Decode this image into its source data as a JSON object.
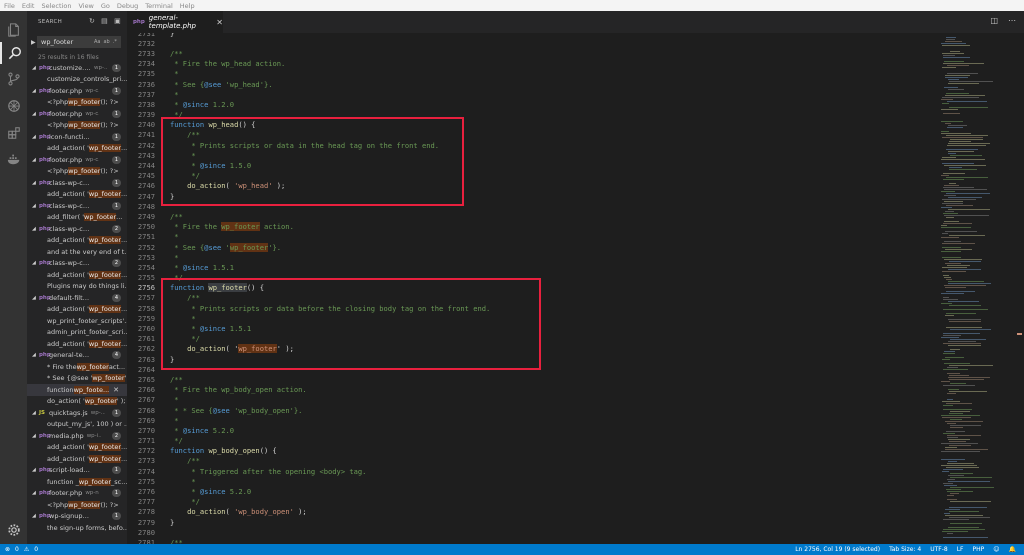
{
  "menubar": [
    "File",
    "Edit",
    "Selection",
    "View",
    "Go",
    "Debug",
    "Terminal",
    "Help"
  ],
  "sidebar": {
    "title": "SEARCH",
    "query": "wp_footer",
    "case_opt": "Aa",
    "word_opt": "ab",
    "regex_opt": ".*",
    "summary": "25 results in 16 files",
    "results": [
      {
        "kind": "file",
        "icon": "php",
        "name": "customize.php",
        "path": "wp-...",
        "count": "1"
      },
      {
        "kind": "match",
        "parts": [
          "customize_controls_pri..."
        ]
      },
      {
        "kind": "file",
        "icon": "php",
        "name": "footer.php",
        "path": "wp-c...",
        "count": "1"
      },
      {
        "kind": "match",
        "parts": [
          "<?php ",
          {
            "h": "wp_footer"
          },
          "(); ?>"
        ]
      },
      {
        "kind": "file",
        "icon": "php",
        "name": "footer.php",
        "path": "wp-c...",
        "count": "1"
      },
      {
        "kind": "match",
        "parts": [
          "<?php ",
          {
            "h": "wp_footer"
          },
          "(); ?>"
        ]
      },
      {
        "kind": "file",
        "icon": "php",
        "name": "icon-functions.p...",
        "path": "",
        "count": "1"
      },
      {
        "kind": "match",
        "parts": [
          "add_action( '",
          {
            "h": "wp_footer"
          },
          "..."
        ]
      },
      {
        "kind": "file",
        "icon": "php",
        "name": "footer.php",
        "path": "wp-c...",
        "count": "1"
      },
      {
        "kind": "match",
        "parts": [
          "<?php ",
          {
            "h": "wp_footer"
          },
          "(); ?>"
        ]
      },
      {
        "kind": "file",
        "icon": "php",
        "name": "class-wp-custo...",
        "path": "",
        "count": "1"
      },
      {
        "kind": "match",
        "parts": [
          "add_action( '",
          {
            "h": "wp_footer"
          },
          "..."
        ]
      },
      {
        "kind": "file",
        "icon": "php",
        "name": "class-wp-custo...",
        "path": "",
        "count": "1"
      },
      {
        "kind": "match",
        "parts": [
          "add_filter( '",
          {
            "h": "wp_footer"
          },
          "..."
        ]
      },
      {
        "kind": "file",
        "icon": "php",
        "name": "class-wp-custo...",
        "path": "",
        "count": "2"
      },
      {
        "kind": "match",
        "parts": [
          "add_action( '",
          {
            "h": "wp_footer"
          },
          "..."
        ]
      },
      {
        "kind": "match",
        "parts": [
          "and at the very end of t..."
        ]
      },
      {
        "kind": "file",
        "icon": "php",
        "name": "class-wp-custo...",
        "path": "",
        "count": "2"
      },
      {
        "kind": "match",
        "parts": [
          "add_action( '",
          {
            "h": "wp_footer"
          },
          "..."
        ]
      },
      {
        "kind": "match",
        "parts": [
          "Plugins may do things li..."
        ]
      },
      {
        "kind": "file",
        "icon": "php",
        "name": "default-filters.ph...",
        "path": "",
        "count": "4"
      },
      {
        "kind": "match",
        "parts": [
          "add_action( '",
          {
            "h": "wp_footer"
          },
          "..."
        ]
      },
      {
        "kind": "match",
        "parts": [
          "wp_print_footer_scripts'..."
        ]
      },
      {
        "kind": "match",
        "parts": [
          "admin_print_footer_scri..."
        ]
      },
      {
        "kind": "match",
        "parts": [
          "add_action( '",
          {
            "h": "wp_footer"
          },
          "..."
        ]
      },
      {
        "kind": "file",
        "icon": "php",
        "name": "general-templat...",
        "path": "",
        "count": "4"
      },
      {
        "kind": "match",
        "parts": [
          "* Fire the ",
          {
            "h": "wp_footer"
          },
          " act..."
        ]
      },
      {
        "kind": "match",
        "parts": [
          "* See {@see '",
          {
            "h": "wp_footer"
          },
          "'}."
        ]
      },
      {
        "kind": "match",
        "selected": true,
        "parts": [
          "function ",
          {
            "h": "wp_foote..."
          }
        ]
      },
      {
        "kind": "match",
        "parts": [
          "do_action( '",
          {
            "h": "wp_footer"
          },
          "' );"
        ]
      },
      {
        "kind": "file",
        "icon": "js",
        "name": "quicktags.js",
        "path": "wp-...",
        "count": "1"
      },
      {
        "kind": "match",
        "parts": [
          "output_my_js', 100 ) or ..."
        ]
      },
      {
        "kind": "file",
        "icon": "php",
        "name": "media.php",
        "path": "wp-i...",
        "count": "2"
      },
      {
        "kind": "match",
        "parts": [
          "add_action( '",
          {
            "h": "wp_footer"
          },
          "..."
        ]
      },
      {
        "kind": "match",
        "parts": [
          "add_action( '",
          {
            "h": "wp_footer"
          },
          "..."
        ]
      },
      {
        "kind": "file",
        "icon": "php",
        "name": "script-loader.ph...",
        "path": "",
        "count": "1"
      },
      {
        "kind": "match",
        "parts": [
          "function _",
          {
            "h": "wp_footer"
          },
          "_sc..."
        ]
      },
      {
        "kind": "file",
        "icon": "php",
        "name": "footer.php",
        "path": "wp-n...",
        "count": "1"
      },
      {
        "kind": "match",
        "parts": [
          "<?php ",
          {
            "h": "wp_footer"
          },
          "(); ?>"
        ]
      },
      {
        "kind": "file",
        "icon": "php",
        "name": "wp-signup.php",
        "path": "",
        "count": "1"
      },
      {
        "kind": "match",
        "parts": [
          "the sign-up forms, befo..."
        ]
      }
    ]
  },
  "tab": {
    "label": "general-template.php",
    "icon": "php"
  },
  "editor": {
    "current_line": "2756",
    "lines": [
      {
        "n": "2731",
        "t": [
          [
            "}",
            ""
          ]
        ]
      },
      {
        "n": "2732",
        "t": []
      },
      {
        "n": "2733",
        "t": [
          [
            "/**",
            "c"
          ]
        ]
      },
      {
        "n": "2734",
        "t": [
          [
            " * Fire the wp_head action.",
            "c"
          ]
        ]
      },
      {
        "n": "2735",
        "t": [
          [
            " *",
            "c"
          ]
        ]
      },
      {
        "n": "2736",
        "t": [
          [
            " * See {",
            "c"
          ],
          [
            "@see",
            "kw"
          ],
          [
            " 'wp_head'}.",
            "c"
          ]
        ]
      },
      {
        "n": "2737",
        "t": [
          [
            " *",
            "c"
          ]
        ]
      },
      {
        "n": "2738",
        "t": [
          [
            " * ",
            "c"
          ],
          [
            "@since",
            "kw"
          ],
          [
            " 1.2.0",
            "c"
          ]
        ]
      },
      {
        "n": "2739",
        "t": [
          [
            " */",
            "c"
          ]
        ]
      },
      {
        "n": "2740",
        "t": [
          [
            "function",
            "kw"
          ],
          [
            " ",
            ""
          ],
          [
            "wp_head",
            "fnname"
          ],
          [
            "() {",
            ""
          ]
        ]
      },
      {
        "n": "2741",
        "t": [
          [
            "    /**",
            "c"
          ]
        ]
      },
      {
        "n": "2742",
        "t": [
          [
            "     * Prints scripts or data in the head tag on the front end.",
            "c"
          ]
        ]
      },
      {
        "n": "2743",
        "t": [
          [
            "     *",
            "c"
          ]
        ]
      },
      {
        "n": "2744",
        "t": [
          [
            "     * ",
            "c"
          ],
          [
            "@since",
            "kw"
          ],
          [
            " 1.5.0",
            "c"
          ]
        ]
      },
      {
        "n": "2745",
        "t": [
          [
            "     */",
            "c"
          ]
        ]
      },
      {
        "n": "2746",
        "t": [
          [
            "    ",
            ""
          ],
          [
            "do_action",
            "fnname"
          ],
          [
            "( ",
            ""
          ],
          [
            "'wp_head'",
            "str"
          ],
          [
            " );",
            ""
          ]
        ]
      },
      {
        "n": "2747",
        "t": [
          [
            "}",
            ""
          ]
        ]
      },
      {
        "n": "2748",
        "t": []
      },
      {
        "n": "2749",
        "t": [
          [
            "/**",
            "c"
          ]
        ]
      },
      {
        "n": "2750",
        "t": [
          [
            " * Fire the ",
            "c"
          ],
          [
            "wp_footer",
            "c wfhl"
          ],
          [
            " action.",
            "c"
          ]
        ]
      },
      {
        "n": "2751",
        "t": [
          [
            " *",
            "c"
          ]
        ]
      },
      {
        "n": "2752",
        "t": [
          [
            " * See {",
            "c"
          ],
          [
            "@see",
            "kw"
          ],
          [
            " '",
            "c"
          ],
          [
            "wp_footer",
            "c wfhl"
          ],
          [
            "'}.",
            "c"
          ]
        ]
      },
      {
        "n": "2753",
        "t": [
          [
            " *",
            "c"
          ]
        ]
      },
      {
        "n": "2754",
        "t": [
          [
            " * ",
            "c"
          ],
          [
            "@since",
            "kw"
          ],
          [
            " 1.5.1",
            "c"
          ]
        ]
      },
      {
        "n": "2755",
        "t": [
          [
            " */",
            "c"
          ]
        ]
      },
      {
        "n": "2756",
        "t": [
          [
            "function",
            "kw"
          ],
          [
            " ",
            ""
          ],
          [
            "wp_footer",
            "fnname wfsel"
          ],
          [
            "() {",
            ""
          ]
        ]
      },
      {
        "n": "2757",
        "t": [
          [
            "    /**",
            "c"
          ]
        ]
      },
      {
        "n": "2758",
        "t": [
          [
            "     * Prints scripts or data before the closing body tag on the front end.",
            "c"
          ]
        ]
      },
      {
        "n": "2759",
        "t": [
          [
            "     *",
            "c"
          ]
        ]
      },
      {
        "n": "2760",
        "t": [
          [
            "     * ",
            "c"
          ],
          [
            "@since",
            "kw"
          ],
          [
            " 1.5.1",
            "c"
          ]
        ]
      },
      {
        "n": "2761",
        "t": [
          [
            "     */",
            "c"
          ]
        ]
      },
      {
        "n": "2762",
        "t": [
          [
            "    ",
            ""
          ],
          [
            "do_action",
            "fnname"
          ],
          [
            "( '",
            ""
          ],
          [
            "wp_footer",
            "str wfhl"
          ],
          [
            "' );",
            ""
          ]
        ]
      },
      {
        "n": "2763",
        "t": [
          [
            "}",
            ""
          ]
        ]
      },
      {
        "n": "2764",
        "t": []
      },
      {
        "n": "2765",
        "t": [
          [
            "/**",
            "c"
          ]
        ]
      },
      {
        "n": "2766",
        "t": [
          [
            " * Fire the wp_body_open action.",
            "c"
          ]
        ]
      },
      {
        "n": "2767",
        "t": [
          [
            " *",
            "c"
          ]
        ]
      },
      {
        "n": "2768",
        "t": [
          [
            " * * See {",
            "c"
          ],
          [
            "@see",
            "kw"
          ],
          [
            " 'wp_body_open'}.",
            "c"
          ]
        ]
      },
      {
        "n": "2769",
        "t": [
          [
            " *",
            "c"
          ]
        ]
      },
      {
        "n": "2770",
        "t": [
          [
            " * ",
            "c"
          ],
          [
            "@since",
            "kw"
          ],
          [
            " 5.2.0",
            "c"
          ]
        ]
      },
      {
        "n": "2771",
        "t": [
          [
            " */",
            "c"
          ]
        ]
      },
      {
        "n": "2772",
        "t": [
          [
            "function",
            "kw"
          ],
          [
            " ",
            ""
          ],
          [
            "wp_body_open",
            "fnname"
          ],
          [
            "() {",
            ""
          ]
        ]
      },
      {
        "n": "2773",
        "t": [
          [
            "    /**",
            "c"
          ]
        ]
      },
      {
        "n": "2774",
        "t": [
          [
            "     * Triggered after the opening <body> tag.",
            "c"
          ]
        ]
      },
      {
        "n": "2775",
        "t": [
          [
            "     *",
            "c"
          ]
        ]
      },
      {
        "n": "2776",
        "t": [
          [
            "     * ",
            "c"
          ],
          [
            "@since",
            "kw"
          ],
          [
            " 5.2.0",
            "c"
          ]
        ]
      },
      {
        "n": "2777",
        "t": [
          [
            "     */",
            "c"
          ]
        ]
      },
      {
        "n": "2778",
        "t": [
          [
            "    ",
            ""
          ],
          [
            "do_action",
            "fnname"
          ],
          [
            "( ",
            ""
          ],
          [
            "'wp_body_open'",
            "str"
          ],
          [
            " );",
            ""
          ]
        ]
      },
      {
        "n": "2779",
        "t": [
          [
            "}",
            ""
          ]
        ]
      },
      {
        "n": "2780",
        "t": []
      },
      {
        "n": "2781",
        "t": [
          [
            "/**",
            "c"
          ]
        ]
      }
    ]
  },
  "status": {
    "errors": "0",
    "warnings": "0",
    "position": "Ln 2756, Col 19 (9 selected)",
    "tab_size": "Tab Size: 4",
    "encoding": "UTF-8",
    "eol": "LF",
    "language": "PHP"
  },
  "colors": {
    "accent": "#007acc",
    "annotation": "#e8203e",
    "match_highlight": "#613214"
  }
}
